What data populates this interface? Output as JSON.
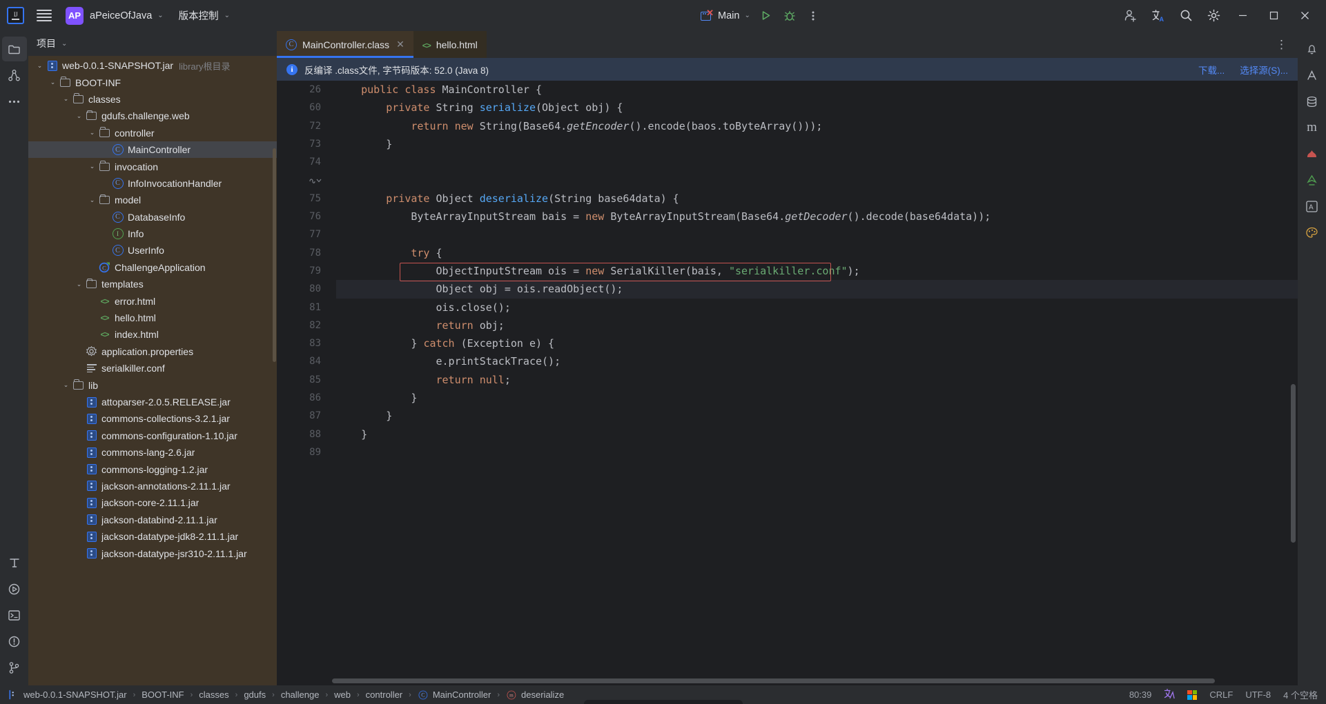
{
  "titlebar": {
    "logo_name": "IJ",
    "project_badge": "AP",
    "project_name": "aPeiceOfJava",
    "vcs_label": "版本控制",
    "run_config": "Main",
    "chevron": "⌄"
  },
  "left_stripe": [
    {
      "name": "project-tool-window",
      "icon": "folder-icon",
      "active": true
    },
    {
      "name": "structure-tool-window",
      "icon": "structure-icon",
      "active": false
    },
    {
      "name": "more-tool-windows",
      "icon": "ellipsis-icon",
      "active": false
    }
  ],
  "left_stripe_bottom": [
    {
      "name": "typography-tool",
      "icon": "text-icon"
    },
    {
      "name": "run-tool-window",
      "icon": "play-circle-icon"
    },
    {
      "name": "terminal-tool-window",
      "icon": "terminal-icon"
    },
    {
      "name": "problems-tool-window",
      "icon": "warning-circle-icon"
    },
    {
      "name": "version-control-tool-window",
      "icon": "branch-icon"
    }
  ],
  "right_stripe": [
    {
      "name": "notifications",
      "icon": "bell-icon"
    },
    {
      "name": "ai-assistant",
      "icon": "ai-icon"
    },
    {
      "name": "database",
      "icon": "database-icon"
    },
    {
      "name": "maven",
      "icon": "maven-m-icon"
    },
    {
      "name": "profiler",
      "icon": "profiler-icon"
    },
    {
      "name": "bookmarks",
      "icon": "bookmark-icon"
    },
    {
      "name": "translation",
      "icon": "translate-a-icon"
    },
    {
      "name": "theme",
      "icon": "palette-icon"
    }
  ],
  "project_panel": {
    "header_title": "项目",
    "header_chevron": "⌄",
    "tree": [
      {
        "indent": 2,
        "arrow": "⌄",
        "icon": "jar-icon",
        "label": "web-0.0.1-SNAPSHOT.jar",
        "sub": "library根目录",
        "selected": false
      },
      {
        "indent": 3,
        "arrow": "⌄",
        "icon": "folder-icon",
        "label": "BOOT-INF",
        "sub": "",
        "selected": false
      },
      {
        "indent": 4,
        "arrow": "⌄",
        "icon": "folder-icon",
        "label": "classes",
        "sub": "",
        "selected": false
      },
      {
        "indent": 5,
        "arrow": "⌄",
        "icon": "folder-icon",
        "label": "gdufs.challenge.web",
        "sub": "",
        "selected": false
      },
      {
        "indent": 6,
        "arrow": "⌄",
        "icon": "folder-icon",
        "label": "controller",
        "sub": "",
        "selected": false
      },
      {
        "indent": 7,
        "arrow": "",
        "icon": "class-icon",
        "label": "MainController",
        "sub": "",
        "selected": true
      },
      {
        "indent": 6,
        "arrow": "⌄",
        "icon": "folder-icon",
        "label": "invocation",
        "sub": "",
        "selected": false
      },
      {
        "indent": 7,
        "arrow": "",
        "icon": "class-icon",
        "label": "InfoInvocationHandler",
        "sub": "",
        "selected": false
      },
      {
        "indent": 6,
        "arrow": "⌄",
        "icon": "folder-icon",
        "label": "model",
        "sub": "",
        "selected": false
      },
      {
        "indent": 7,
        "arrow": "",
        "icon": "class-icon",
        "label": "DatabaseInfo",
        "sub": "",
        "selected": false
      },
      {
        "indent": 7,
        "arrow": "",
        "icon": "interface-icon",
        "label": "Info",
        "sub": "",
        "selected": false
      },
      {
        "indent": 7,
        "arrow": "",
        "icon": "class-icon",
        "label": "UserInfo",
        "sub": "",
        "selected": false
      },
      {
        "indent": 6,
        "arrow": "",
        "icon": "runnable-class-icon",
        "label": "ChallengeApplication",
        "sub": "",
        "selected": false
      },
      {
        "indent": 5,
        "arrow": "⌄",
        "icon": "folder-icon",
        "label": "templates",
        "sub": "",
        "selected": false
      },
      {
        "indent": 6,
        "arrow": "",
        "icon": "html-icon",
        "label": "error.html",
        "sub": "",
        "selected": false
      },
      {
        "indent": 6,
        "arrow": "",
        "icon": "html-icon",
        "label": "hello.html",
        "sub": "",
        "selected": false
      },
      {
        "indent": 6,
        "arrow": "",
        "icon": "html-icon",
        "label": "index.html",
        "sub": "",
        "selected": false
      },
      {
        "indent": 5,
        "arrow": "",
        "icon": "properties-icon",
        "label": "application.properties",
        "sub": "",
        "selected": false
      },
      {
        "indent": 5,
        "arrow": "",
        "icon": "conf-icon",
        "label": "serialkiller.conf",
        "sub": "",
        "selected": false
      },
      {
        "indent": 4,
        "arrow": "⌄",
        "icon": "folder-icon",
        "label": "lib",
        "sub": "",
        "selected": false
      },
      {
        "indent": 5,
        "arrow": "",
        "icon": "jar-icon",
        "label": "attoparser-2.0.5.RELEASE.jar",
        "sub": "",
        "selected": false
      },
      {
        "indent": 5,
        "arrow": "",
        "icon": "jar-icon",
        "label": "commons-collections-3.2.1.jar",
        "sub": "",
        "selected": false
      },
      {
        "indent": 5,
        "arrow": "",
        "icon": "jar-icon",
        "label": "commons-configuration-1.10.jar",
        "sub": "",
        "selected": false
      },
      {
        "indent": 5,
        "arrow": "",
        "icon": "jar-icon",
        "label": "commons-lang-2.6.jar",
        "sub": "",
        "selected": false
      },
      {
        "indent": 5,
        "arrow": "",
        "icon": "jar-icon",
        "label": "commons-logging-1.2.jar",
        "sub": "",
        "selected": false
      },
      {
        "indent": 5,
        "arrow": "",
        "icon": "jar-icon",
        "label": "jackson-annotations-2.11.1.jar",
        "sub": "",
        "selected": false
      },
      {
        "indent": 5,
        "arrow": "",
        "icon": "jar-icon",
        "label": "jackson-core-2.11.1.jar",
        "sub": "",
        "selected": false
      },
      {
        "indent": 5,
        "arrow": "",
        "icon": "jar-icon",
        "label": "jackson-databind-2.11.1.jar",
        "sub": "",
        "selected": false
      },
      {
        "indent": 5,
        "arrow": "",
        "icon": "jar-icon",
        "label": "jackson-datatype-jdk8-2.11.1.jar",
        "sub": "",
        "selected": false
      },
      {
        "indent": 5,
        "arrow": "",
        "icon": "jar-icon",
        "label": "jackson-datatype-jsr310-2.11.1.jar",
        "sub": "",
        "selected": false
      }
    ]
  },
  "editor": {
    "tabs": [
      {
        "label": "MainController.class",
        "icon": "class-icon",
        "active": true,
        "closable": true,
        "close_glyph": "✕"
      },
      {
        "label": "hello.html",
        "icon": "html-icon",
        "active": false,
        "closable": false,
        "close_glyph": ""
      }
    ],
    "tab_overflow": "⋮",
    "banner": {
      "icon": "info-icon",
      "text": "反编译 .class文件, 字节码版本: 52.0 (Java 8)",
      "link_download": "下载...",
      "link_choose": "选择源(S)..."
    },
    "lines": [
      {
        "num": "26",
        "gutter_icon": "",
        "highlight": false,
        "tokens": [
          {
            "t": "    ",
            "c": ""
          },
          {
            "t": "public",
            "c": "kw"
          },
          {
            "t": " ",
            "c": ""
          },
          {
            "t": "class",
            "c": "kw"
          },
          {
            "t": " MainController {",
            "c": ""
          }
        ]
      },
      {
        "num": "60",
        "gutter_icon": "",
        "highlight": false,
        "tokens": [
          {
            "t": "        ",
            "c": ""
          },
          {
            "t": "private",
            "c": "kw"
          },
          {
            "t": " String ",
            "c": ""
          },
          {
            "t": "serialize",
            "c": "fn"
          },
          {
            "t": "(Object obj) {",
            "c": ""
          }
        ]
      },
      {
        "num": "72",
        "gutter_icon": "",
        "highlight": false,
        "tokens": [
          {
            "t": "            ",
            "c": ""
          },
          {
            "t": "return",
            "c": "kw"
          },
          {
            "t": " ",
            "c": ""
          },
          {
            "t": "new",
            "c": "kw"
          },
          {
            "t": " String(Base64.",
            "c": ""
          },
          {
            "t": "getEncoder",
            "c": "fi"
          },
          {
            "t": "().encode(baos.toByteArray()));",
            "c": ""
          }
        ]
      },
      {
        "num": "73",
        "gutter_icon": "",
        "highlight": false,
        "tokens": [
          {
            "t": "        }",
            "c": ""
          }
        ]
      },
      {
        "num": "74",
        "gutter_icon": "",
        "highlight": false,
        "tokens": [
          {
            "t": "",
            "c": ""
          }
        ]
      },
      {
        "num": "",
        "gutter_icon": "method-separator-icon",
        "highlight": false,
        "tokens": [
          {
            "t": "",
            "c": ""
          }
        ]
      },
      {
        "num": "75",
        "gutter_icon": "",
        "highlight": false,
        "tokens": [
          {
            "t": "        ",
            "c": ""
          },
          {
            "t": "private",
            "c": "kw"
          },
          {
            "t": " Object ",
            "c": ""
          },
          {
            "t": "deserialize",
            "c": "fn"
          },
          {
            "t": "(String base64data) {",
            "c": ""
          }
        ]
      },
      {
        "num": "76",
        "gutter_icon": "",
        "highlight": false,
        "tokens": [
          {
            "t": "            ByteArrayInputStream bais = ",
            "c": ""
          },
          {
            "t": "new",
            "c": "kw"
          },
          {
            "t": " ByteArrayInputStream(Base64.",
            "c": ""
          },
          {
            "t": "getDecoder",
            "c": "fi"
          },
          {
            "t": "().decode(base64data));",
            "c": ""
          }
        ]
      },
      {
        "num": "77",
        "gutter_icon": "",
        "highlight": false,
        "tokens": [
          {
            "t": "",
            "c": ""
          }
        ]
      },
      {
        "num": "78",
        "gutter_icon": "",
        "highlight": false,
        "tokens": [
          {
            "t": "            ",
            "c": ""
          },
          {
            "t": "try",
            "c": "kw"
          },
          {
            "t": " {",
            "c": ""
          }
        ]
      },
      {
        "num": "79",
        "gutter_icon": "",
        "highlight": false,
        "tokens": [
          {
            "t": "                ObjectInputStream ois = ",
            "c": ""
          },
          {
            "t": "new",
            "c": "kw"
          },
          {
            "t": " SerialKiller(bais, ",
            "c": ""
          },
          {
            "t": "\"serialkiller.conf\"",
            "c": "str"
          },
          {
            "t": ");",
            "c": ""
          }
        ]
      },
      {
        "num": "80",
        "gutter_icon": "",
        "highlight": true,
        "tokens": [
          {
            "t": "                Object obj = ois.readObject();",
            "c": ""
          }
        ]
      },
      {
        "num": "81",
        "gutter_icon": "",
        "highlight": false,
        "tokens": [
          {
            "t": "                ois.close();",
            "c": ""
          }
        ]
      },
      {
        "num": "82",
        "gutter_icon": "",
        "highlight": false,
        "tokens": [
          {
            "t": "                ",
            "c": ""
          },
          {
            "t": "return",
            "c": "kw"
          },
          {
            "t": " obj;",
            "c": ""
          }
        ]
      },
      {
        "num": "83",
        "gutter_icon": "",
        "highlight": false,
        "tokens": [
          {
            "t": "            } ",
            "c": ""
          },
          {
            "t": "catch",
            "c": "kw"
          },
          {
            "t": " (Exception e) {",
            "c": ""
          }
        ]
      },
      {
        "num": "84",
        "gutter_icon": "",
        "highlight": false,
        "tokens": [
          {
            "t": "                e.printStackTrace();",
            "c": ""
          }
        ]
      },
      {
        "num": "85",
        "gutter_icon": "",
        "highlight": false,
        "tokens": [
          {
            "t": "                ",
            "c": ""
          },
          {
            "t": "return",
            "c": "kw"
          },
          {
            "t": " ",
            "c": ""
          },
          {
            "t": "null",
            "c": "kw"
          },
          {
            "t": ";",
            "c": ""
          }
        ]
      },
      {
        "num": "86",
        "gutter_icon": "",
        "highlight": false,
        "tokens": [
          {
            "t": "            }",
            "c": ""
          }
        ]
      },
      {
        "num": "87",
        "gutter_icon": "",
        "highlight": false,
        "tokens": [
          {
            "t": "        }",
            "c": ""
          }
        ]
      },
      {
        "num": "88",
        "gutter_icon": "",
        "highlight": false,
        "tokens": [
          {
            "t": "    }",
            "c": ""
          }
        ]
      },
      {
        "num": "89",
        "gutter_icon": "",
        "highlight": false,
        "tokens": [
          {
            "t": "",
            "c": ""
          }
        ]
      }
    ]
  },
  "statusbar": {
    "breadcrumbs": [
      {
        "label": "web-0.0.1-SNAPSHOT.jar",
        "icon": "jar-icon"
      },
      {
        "label": "BOOT-INF",
        "icon": ""
      },
      {
        "label": "classes",
        "icon": ""
      },
      {
        "label": "gdufs",
        "icon": ""
      },
      {
        "label": "challenge",
        "icon": ""
      },
      {
        "label": "web",
        "icon": ""
      },
      {
        "label": "controller",
        "icon": ""
      },
      {
        "label": "MainController",
        "icon": "class-icon"
      },
      {
        "label": "deserialize",
        "icon": "method-icon"
      }
    ],
    "separator": "›",
    "caret_position": "80:39",
    "line_separator": "CRLF",
    "encoding": "UTF-8",
    "indent": "4 个空格",
    "translate_icon": "translate-icon",
    "ms_icon": "windows-icon"
  },
  "colors": {
    "accent_blue": "#3574f0",
    "highlight_red": "#c75450",
    "panel_brown": "#3f3528",
    "editor_bg": "#1e1f22",
    "chrome_bg": "#2b2d30",
    "banner_bg": "#2f3a4d",
    "string_green": "#6aab73",
    "keyword_orange": "#cf8e6d"
  }
}
